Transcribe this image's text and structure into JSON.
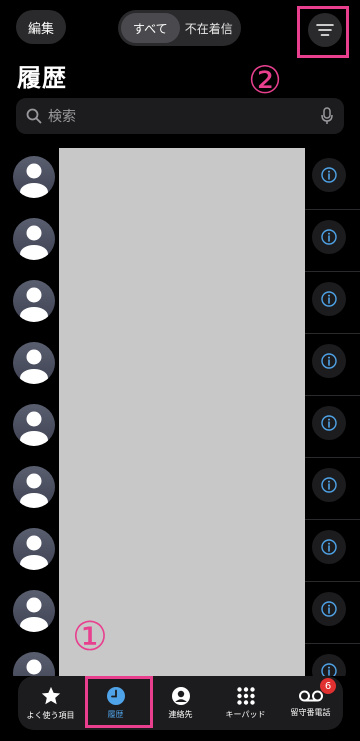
{
  "header": {
    "edit_label": "編集",
    "tabs": [
      {
        "label": "すべて",
        "active": true
      },
      {
        "label": "不在着信",
        "active": false
      }
    ],
    "title": "履歴"
  },
  "search": {
    "placeholder": "検索"
  },
  "annotations": {
    "one": "①",
    "two": "②",
    "color": "#e8408f"
  },
  "recents": {
    "row_count": 9,
    "redacted_color": "#c8c8c8"
  },
  "tabbar": {
    "items": [
      {
        "label": "よく使う項目",
        "icon": "star-icon",
        "active": false
      },
      {
        "label": "履歴",
        "icon": "clock-icon",
        "active": true
      },
      {
        "label": "連絡先",
        "icon": "person-circle-icon",
        "active": false
      },
      {
        "label": "キーパッド",
        "icon": "keypad-icon",
        "active": false
      },
      {
        "label": "留守番電話",
        "icon": "voicemail-icon",
        "active": false,
        "badge": "6"
      }
    ],
    "active_color": "#4fa3e8"
  }
}
